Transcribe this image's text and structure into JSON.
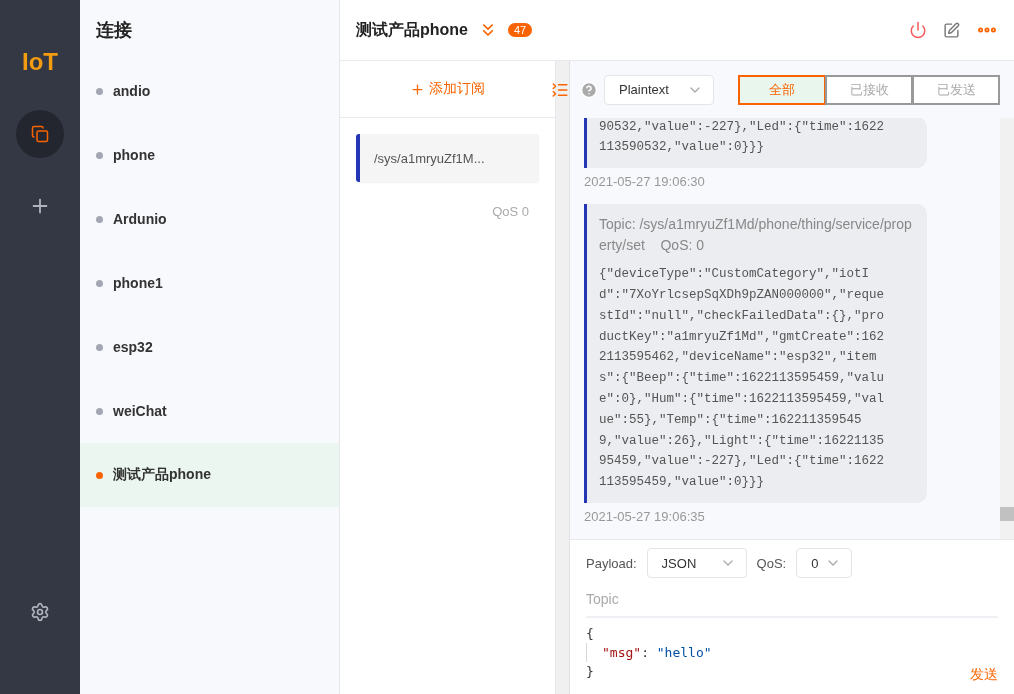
{
  "app": {
    "logo": "IoT"
  },
  "nav": [
    {
      "kind": "connections",
      "selected": true
    },
    {
      "kind": "add",
      "selected": false
    },
    {
      "kind": "settings",
      "selected": false
    }
  ],
  "connections": {
    "title": "连接",
    "items": [
      {
        "name": "andio",
        "selected": false,
        "color": "#a3a7b2"
      },
      {
        "name": "phone",
        "selected": false,
        "color": "#a3a7b2"
      },
      {
        "name": "Ardunio",
        "selected": false,
        "color": "#a3a7b2"
      },
      {
        "name": "phone1",
        "selected": false,
        "color": "#a3a7b2"
      },
      {
        "name": "esp32",
        "selected": false,
        "color": "#a3a7b2"
      },
      {
        "name": "weiChat",
        "selected": false,
        "color": "#a3a7b2"
      },
      {
        "name": "测试产品phone",
        "selected": true,
        "color": "#fa6400"
      }
    ]
  },
  "header": {
    "title": "测试产品phone",
    "badge": "47"
  },
  "subscriptions": {
    "add_label": "添加订阅",
    "items": [
      {
        "topic": "/sys/a1mryuZf1M...",
        "qos": "QoS 0",
        "color": "#2435b5"
      }
    ]
  },
  "toolbar": {
    "format": "Plaintext",
    "filters": [
      {
        "label": "全部",
        "selected": true
      },
      {
        "label": "已接收",
        "selected": false
      },
      {
        "label": "已发送",
        "selected": false
      }
    ]
  },
  "messages": [
    {
      "lines": [
        "90532,\"value\":-227},\"Led\":{\"time\":1622",
        "113590532,\"value\":0}}}"
      ],
      "time": "2021-05-27 19:06:30"
    },
    {
      "topic": "Topic: /sys/a1mryuZf1Md/phone/thing/service/property/set",
      "qos": "QoS: 0",
      "lines": [
        "{\"deviceType\":\"CustomCategory\",\"iotI",
        "d\":\"7XoYrlcsepSqXDh9pZAN000000\",\"reque",
        "stId\":\"null\",\"checkFailedData\":{},\"pro",
        "ductKey\":\"a1mryuZf1Md\",\"gmtCreate\":162",
        "2113595462,\"deviceName\":\"esp32\",\"item",
        "s\":{\"Beep\":{\"time\":1622113595459,\"valu",
        "e\":0},\"Hum\":{\"time\":1622113595459,\"val",
        "ue\":55},\"Temp\":{\"time\":162211359545",
        "9,\"value\":26},\"Light\":{\"time\":16221135",
        "95459,\"value\":-227},\"Led\":{\"time\":1622",
        "113595459,\"value\":0}}}"
      ],
      "time": "2021-05-27 19:06:35"
    }
  ],
  "composer": {
    "payload_label": "Payload:",
    "payload": "JSON",
    "qos_label": "QoS:",
    "qos": "0",
    "topic_placeholder": "Topic",
    "code": [
      {
        "indent": false,
        "tokens": [
          {
            "kind": "punct",
            "text": "{"
          }
        ]
      },
      {
        "indent": true,
        "tokens": [
          {
            "kind": "key",
            "text": "\"msg\""
          },
          {
            "kind": "punct",
            "text": ": "
          },
          {
            "kind": "string",
            "text": "\"hello\""
          }
        ]
      },
      {
        "indent": false,
        "tokens": [
          {
            "kind": "punct",
            "text": "}"
          }
        ]
      }
    ],
    "send": "发送"
  }
}
